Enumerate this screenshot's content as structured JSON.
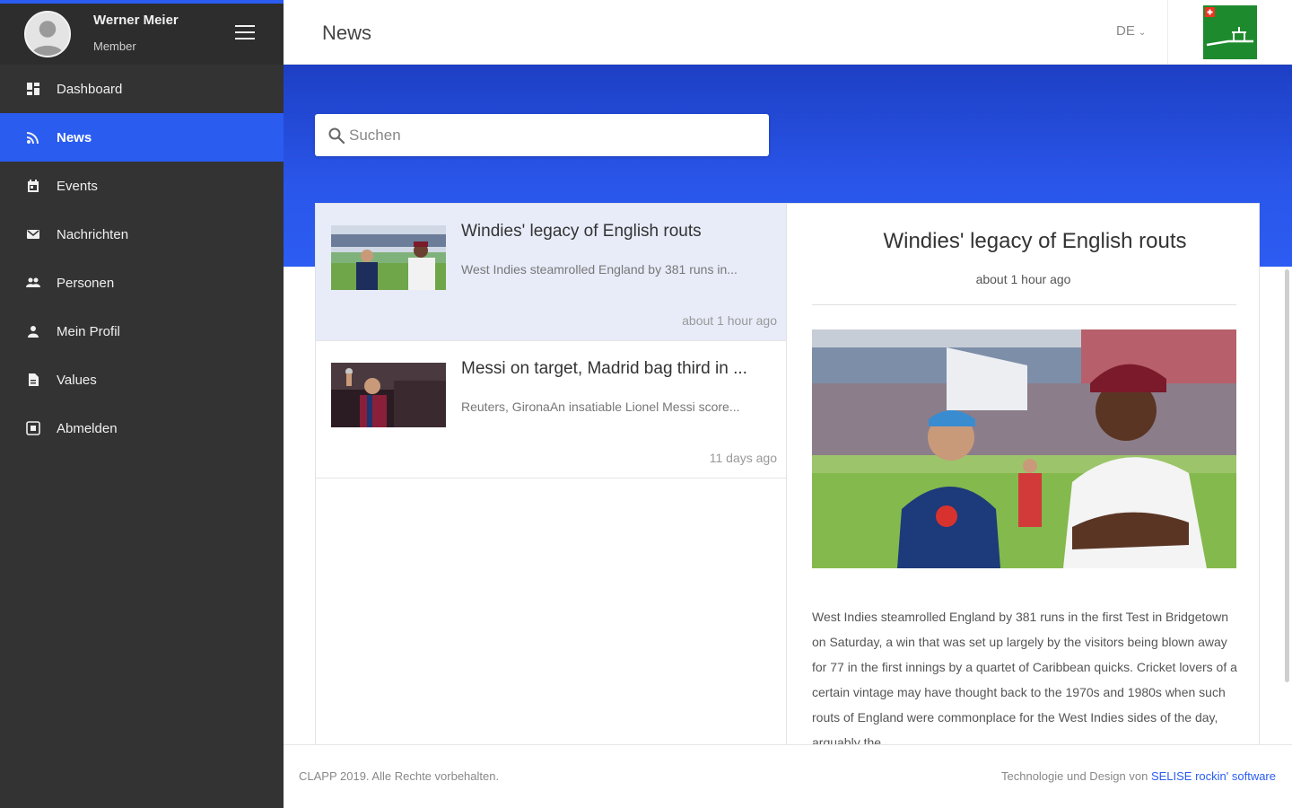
{
  "user": {
    "name": "Werner Meier",
    "role": "Member"
  },
  "header": {
    "title": "News",
    "language": "DE"
  },
  "nav": {
    "items": [
      {
        "label": "Dashboard",
        "icon": "dashboard-icon"
      },
      {
        "label": "News",
        "icon": "rss-icon",
        "active": true
      },
      {
        "label": "Events",
        "icon": "calendar-icon"
      },
      {
        "label": "Nachrichten",
        "icon": "mail-icon"
      },
      {
        "label": "Personen",
        "icon": "people-icon"
      },
      {
        "label": "Mein Profil",
        "icon": "person-icon"
      },
      {
        "label": "Values",
        "icon": "document-icon"
      },
      {
        "label": "Abmelden",
        "icon": "logout-icon"
      }
    ]
  },
  "search": {
    "placeholder": "Suchen",
    "value": ""
  },
  "news": [
    {
      "title": "Windies' legacy of English routs",
      "excerpt": "West Indies steamrolled England by 381 runs in...",
      "time": "about 1 hour ago",
      "selected": true
    },
    {
      "title": "Messi on target, Madrid bag third in ...",
      "excerpt": "Reuters, GironaAn insatiable Lionel Messi score...",
      "time": "11 days ago",
      "selected": false
    }
  ],
  "detail": {
    "title": "Windies' legacy of English routs",
    "time": "about 1 hour ago",
    "body": "West Indies steamrolled England by 381 runs in the first Test in Bridgetown on Saturday, a win that was set up largely by the visitors being blown away for 77 in the first innings by a quartet of Caribbean quicks. Cricket lovers of a certain vintage may have thought back to the 1970s and 1980s when such routs of England were commonplace for the West Indies sides of the day, arguably the"
  },
  "footer": {
    "copyright": "CLAPP 2019. Alle Rechte vorbehalten.",
    "credits_prefix": "Technologie und Design von ",
    "credits_link": "SELISE rockin' software"
  },
  "colors": {
    "accent": "#2a5cf0",
    "sidebar": "#333333",
    "selected_item": "#e8ecf9",
    "logo_green": "#1e8a2e"
  }
}
